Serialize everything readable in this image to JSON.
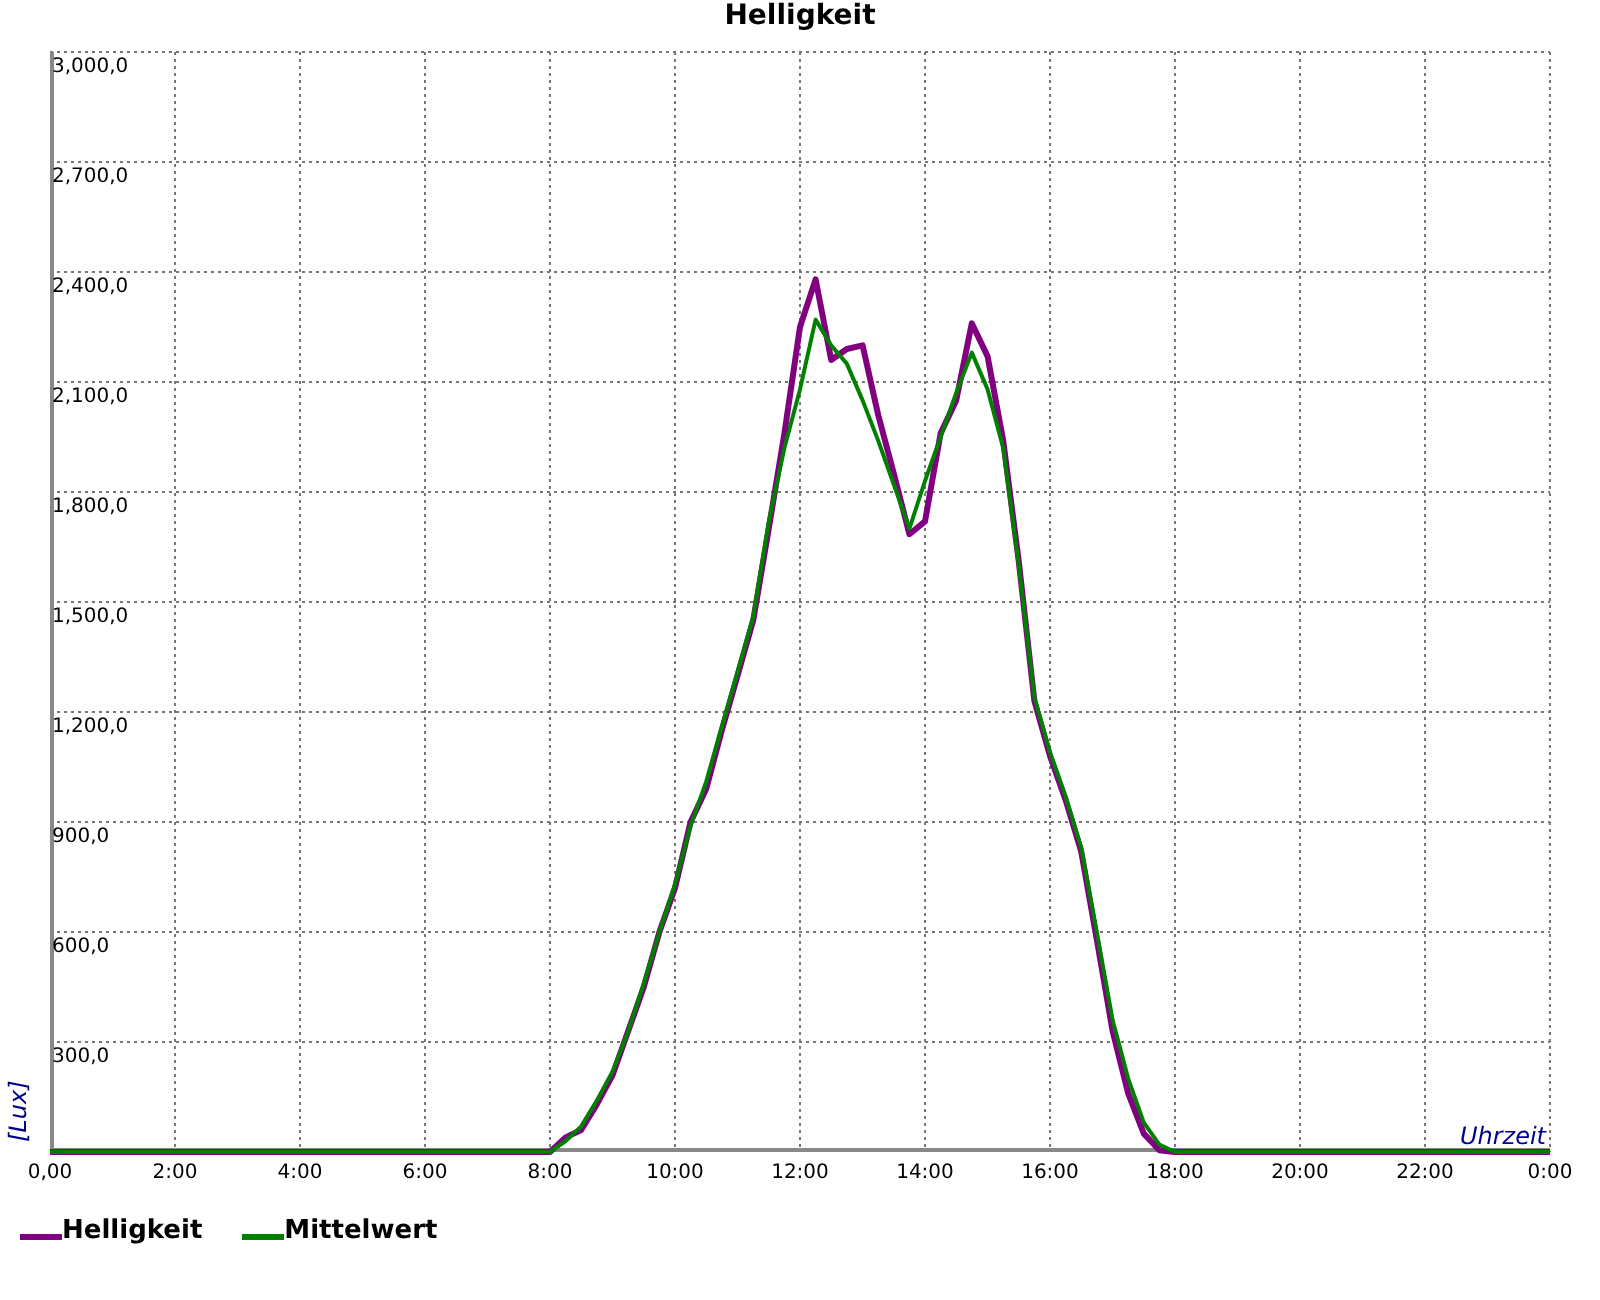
{
  "window": {
    "title": "Helligkeit"
  },
  "chart_data": {
    "type": "line",
    "xlabel": "Uhrzeit",
    "ylabel": "[Lux]",
    "x": [
      0,
      1,
      2,
      3,
      4,
      5,
      6,
      7,
      8,
      8.25,
      8.5,
      8.75,
      9,
      9.25,
      9.5,
      9.75,
      10,
      10.25,
      10.5,
      10.75,
      11,
      11.25,
      11.5,
      11.75,
      12,
      12.25,
      12.5,
      12.75,
      13,
      13.25,
      13.5,
      13.75,
      14,
      14.25,
      14.5,
      14.75,
      15,
      15.25,
      15.5,
      15.75,
      16,
      16.25,
      16.5,
      16.75,
      17,
      17.25,
      17.5,
      17.75,
      18,
      19,
      20,
      21,
      22,
      23,
      24
    ],
    "series": [
      {
        "name": "Helligkeit",
        "color": "#800080",
        "values": [
          0,
          0,
          0,
          0,
          0,
          0,
          0,
          0,
          0,
          40,
          60,
          130,
          210,
          330,
          450,
          600,
          720,
          900,
          990,
          1150,
          1300,
          1450,
          1700,
          1960,
          2250,
          2380,
          2160,
          2190,
          2200,
          2010,
          1850,
          1685,
          1720,
          1960,
          2050,
          2260,
          2170,
          1940,
          1610,
          1230,
          1080,
          960,
          820,
          580,
          330,
          160,
          50,
          5,
          0,
          0,
          0,
          0,
          0,
          0,
          0
        ]
      },
      {
        "name": "Mittelwert",
        "color": "#008000",
        "values": [
          0,
          0,
          0,
          0,
          0,
          0,
          0,
          0,
          0,
          30,
          70,
          140,
          220,
          330,
          460,
          600,
          730,
          890,
          1010,
          1160,
          1310,
          1460,
          1720,
          1920,
          2080,
          2270,
          2200,
          2150,
          2050,
          1940,
          1820,
          1700,
          1830,
          1950,
          2070,
          2180,
          2080,
          1920,
          1600,
          1240,
          1090,
          970,
          830,
          600,
          360,
          200,
          80,
          20,
          0,
          0,
          0,
          0,
          0,
          0,
          0
        ]
      }
    ],
    "xlim": [
      0,
      24
    ],
    "ylim": [
      0,
      3000
    ],
    "grid": true,
    "xticks": [
      {
        "value": 0,
        "label": "0,00"
      },
      {
        "value": 2,
        "label": "2:00"
      },
      {
        "value": 4,
        "label": "4:00"
      },
      {
        "value": 6,
        "label": "6:00"
      },
      {
        "value": 8,
        "label": "8:00"
      },
      {
        "value": 10,
        "label": "10:00"
      },
      {
        "value": 12,
        "label": "12:00"
      },
      {
        "value": 14,
        "label": "14:00"
      },
      {
        "value": 16,
        "label": "16:00"
      },
      {
        "value": 18,
        "label": "18:00"
      },
      {
        "value": 20,
        "label": "20:00"
      },
      {
        "value": 22,
        "label": "22:00"
      },
      {
        "value": 24,
        "label": "0:00"
      }
    ],
    "yticks": [
      {
        "value": 300,
        "label": "300,0"
      },
      {
        "value": 600,
        "label": "600,0"
      },
      {
        "value": 900,
        "label": "900,0"
      },
      {
        "value": 1200,
        "label": "1,200,0"
      },
      {
        "value": 1500,
        "label": "1,500,0"
      },
      {
        "value": 1800,
        "label": "1,800,0"
      },
      {
        "value": 2100,
        "label": "2,100,0"
      },
      {
        "value": 2400,
        "label": "2,400,0"
      },
      {
        "value": 2700,
        "label": "2,700,0"
      },
      {
        "value": 3000,
        "label": "3,000,0"
      }
    ]
  }
}
